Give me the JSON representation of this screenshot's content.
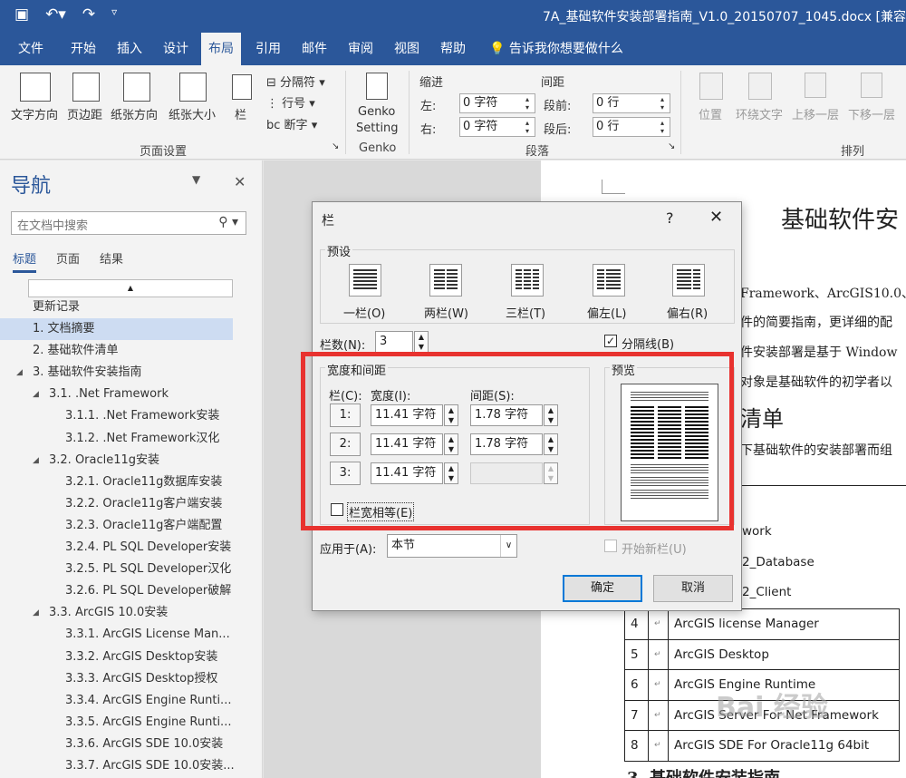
{
  "window": {
    "title": "7A_基础软件安装部署指南_V1.0_20150707_1045.docx [兼容",
    "qat": [
      "save-icon",
      "undo-icon",
      "redo-icon",
      "customize-icon"
    ]
  },
  "ribbon_tabs": [
    "文件",
    "开始",
    "插入",
    "设计",
    "布局",
    "引用",
    "邮件",
    "审阅",
    "视图",
    "帮助"
  ],
  "active_tab": "布局",
  "tell_me": "告诉我你想要做什么",
  "ribbon": {
    "page_setup": {
      "buttons": [
        "文字方向",
        "页边距",
        "纸张方向",
        "纸张大小",
        "栏"
      ],
      "small": [
        "分隔符",
        "行号",
        "断字"
      ],
      "label": "页面设置"
    },
    "genko": {
      "button_line1": "Genko",
      "button_line2": "Setting",
      "label": "Genko"
    },
    "paragraph": {
      "indent_label": "缩进",
      "spacing_label": "间距",
      "left_label": "左:",
      "right_label": "右:",
      "before_label": "段前:",
      "after_label": "段后:",
      "left_value": "0 字符",
      "right_value": "0 字符",
      "before_value": "0 行",
      "after_value": "0 行",
      "label": "段落"
    },
    "arrange": {
      "buttons": [
        "位置",
        "环绕文字",
        "上移一层",
        "下移一层"
      ],
      "label": "排列"
    }
  },
  "nav": {
    "title": "导航",
    "search_placeholder": "在文档中搜索",
    "tabs": [
      "标题",
      "页面",
      "结果"
    ],
    "items": [
      {
        "text": "更新记录",
        "level": 0,
        "tri": false
      },
      {
        "text": "1. 文档摘要",
        "level": 0,
        "tri": false,
        "selected": true
      },
      {
        "text": "2. 基础软件清单",
        "level": 0,
        "tri": false
      },
      {
        "text": "3. 基础软件安装指南",
        "level": 0,
        "tri": true
      },
      {
        "text": "3.1. .Net Framework",
        "level": 1,
        "tri": true
      },
      {
        "text": "3.1.1. .Net Framework安装",
        "level": 2,
        "tri": false
      },
      {
        "text": "3.1.2. .Net Framework汉化",
        "level": 2,
        "tri": false
      },
      {
        "text": "3.2. Oracle11g安装",
        "level": 1,
        "tri": true
      },
      {
        "text": "3.2.1. Oracle11g数据库安装",
        "level": 2,
        "tri": false
      },
      {
        "text": "3.2.2. Oracle11g客户端安装",
        "level": 2,
        "tri": false
      },
      {
        "text": "3.2.3. Oracle11g客户端配置",
        "level": 2,
        "tri": false
      },
      {
        "text": "3.2.4. PL SQL Developer安装",
        "level": 2,
        "tri": false
      },
      {
        "text": "3.2.5. PL SQL Developer汉化",
        "level": 2,
        "tri": false
      },
      {
        "text": "3.2.6. PL SQL Developer破解",
        "level": 2,
        "tri": false
      },
      {
        "text": "3.3. ArcGIS 10.0安装",
        "level": 1,
        "tri": true
      },
      {
        "text": "3.3.1. ArcGIS License Man...",
        "level": 2,
        "tri": false
      },
      {
        "text": "3.3.2. ArcGIS Desktop安装",
        "level": 2,
        "tri": false
      },
      {
        "text": "3.3.3. ArcGIS Desktop授权",
        "level": 2,
        "tri": false
      },
      {
        "text": "3.3.4. ArcGIS Engine Runti...",
        "level": 2,
        "tri": false
      },
      {
        "text": "3.3.5. ArcGIS Engine Runti...",
        "level": 2,
        "tri": false
      },
      {
        "text": "3.3.6. ArcGIS SDE 10.0安装",
        "level": 2,
        "tri": false
      },
      {
        "text": "3.3.7. ArcGIS SDE 10.0安装...",
        "level": 2,
        "tri": false
      }
    ]
  },
  "document": {
    "heading": "基础软件安",
    "lines": [
      "Framework、ArcGIS10.0、C",
      "件的简要指南，更详细的配",
      "件安装部署是基于 Window",
      "对象是基础软件的初学者以"
    ],
    "section_heading": "清单",
    "para2": "下基础软件的安装部署而组",
    "table_partial": [
      "work",
      "2_Database",
      "2_Client"
    ],
    "table_rows": [
      {
        "num": "4",
        "name": "ArcGIS license Manager"
      },
      {
        "num": "5",
        "name": "ArcGIS Desktop"
      },
      {
        "num": "6",
        "name": "ArcGIS Engine Runtime"
      },
      {
        "num": "7",
        "name": "ArcGIS Server For Net Framework"
      },
      {
        "num": "8",
        "name": "ArcGIS SDE For Oracle11g 64bit"
      }
    ],
    "bottom_heading": "3. 基础软件安装指南",
    "watermark": "Bai 经验"
  },
  "dialog": {
    "title": "栏",
    "help": "?",
    "close": "✕",
    "presets_label": "预设",
    "presets": [
      {
        "label": "一栏(O)",
        "cols": 1
      },
      {
        "label": "两栏(W)",
        "cols": 2
      },
      {
        "label": "三栏(T)",
        "cols": 3
      },
      {
        "label": "偏左(L)",
        "cols": 2
      },
      {
        "label": "偏右(R)",
        "cols": 2
      }
    ],
    "num_cols_label": "栏数(N):",
    "num_cols_value": "3",
    "separator_label": "分隔线(B)",
    "separator_checked": true,
    "width_spacing_label": "宽度和间距",
    "col_header": "栏(C):",
    "width_header": "宽度(I):",
    "spacing_header": "间距(S):",
    "rows": [
      {
        "num": "1:",
        "width": "11.41 字符",
        "spacing": "1.78 字符"
      },
      {
        "num": "2:",
        "width": "11.41 字符",
        "spacing": "1.78 字符"
      },
      {
        "num": "3:",
        "width": "11.41 字符",
        "spacing": ""
      }
    ],
    "equal_width_label": "栏宽相等(E)",
    "equal_width_checked": false,
    "preview_label": "预览",
    "apply_label": "应用于(A):",
    "apply_value": "本节",
    "new_col_label": "开始新栏(U)",
    "ok": "确定",
    "cancel": "取消"
  },
  "colors": {
    "accent": "#2b579a",
    "highlight": "#e8322f",
    "focus": "#0078d7"
  }
}
